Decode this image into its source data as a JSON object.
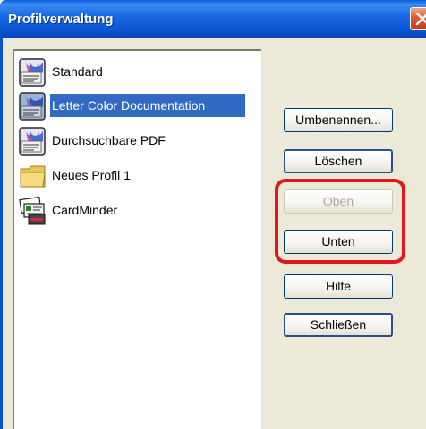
{
  "window": {
    "title": "Profilverwaltung"
  },
  "profiles": [
    {
      "label": "Standard",
      "icon": "scanner-document-icon",
      "selected": false
    },
    {
      "label": "Letter Color Documentation",
      "icon": "scanner-document-icon",
      "selected": true
    },
    {
      "label": "Durchsuchbare PDF",
      "icon": "scanner-document-icon",
      "selected": false
    },
    {
      "label": "Neues Profil 1",
      "icon": "folder-icon",
      "selected": false
    },
    {
      "label": "CardMinder",
      "icon": "cardminder-icon",
      "selected": false
    }
  ],
  "buttons": {
    "rename": "Umbenennen...",
    "delete": "Löschen",
    "up": "Oben",
    "down": "Unten",
    "help": "Hilfe",
    "close": "Schließen"
  },
  "colors": {
    "selection": "#316AC5",
    "highlight_ring": "#E3161D",
    "titlebar": "#0B55D3"
  }
}
